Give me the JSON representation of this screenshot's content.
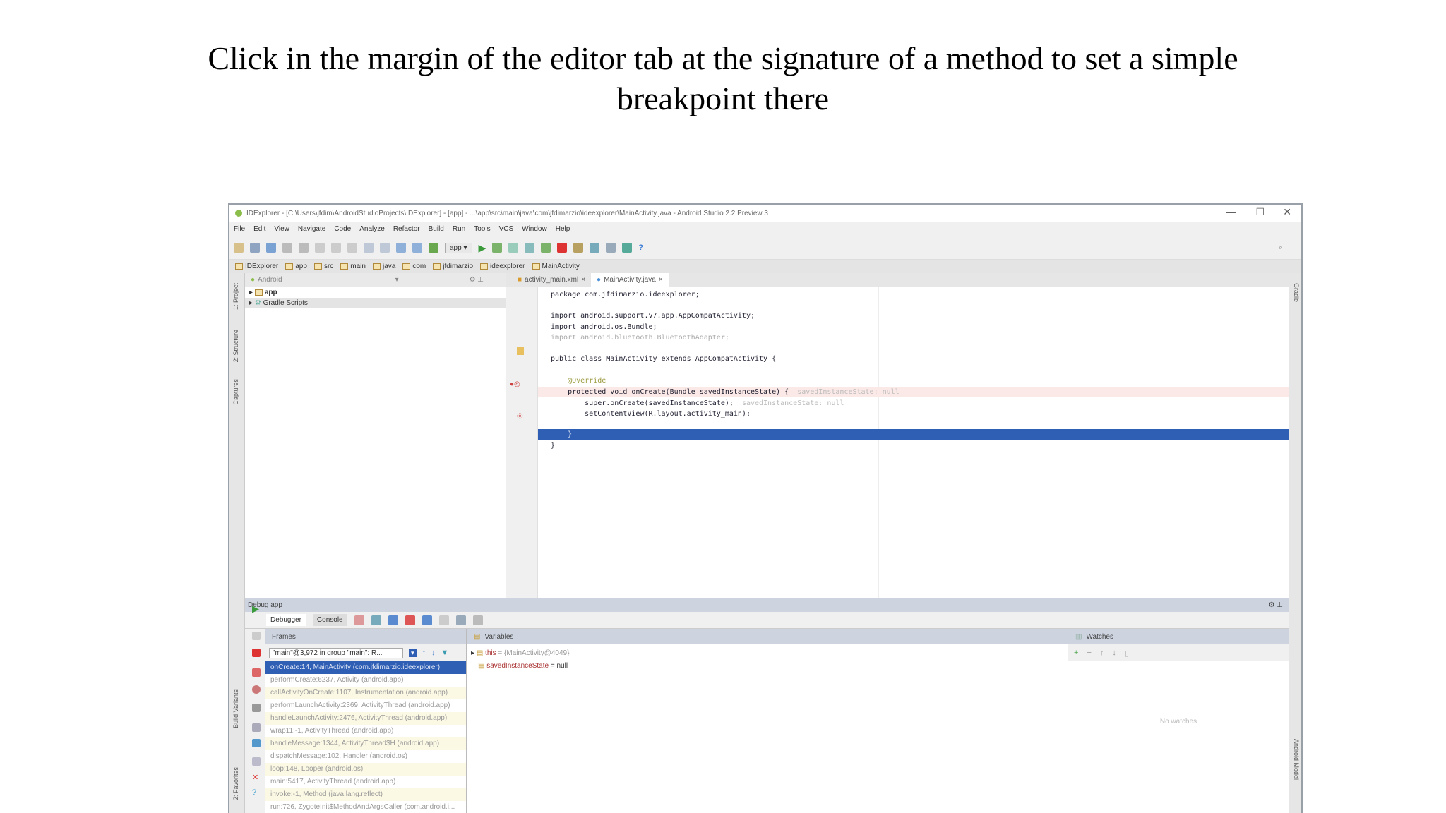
{
  "caption": {
    "line1": "Click in the margin of the editor tab at the signature of a method to set a simple",
    "line2": "breakpoint there"
  },
  "window": {
    "title": "IDExplorer - [C:\\Users\\jfdim\\AndroidStudioProjects\\IDExplorer] - [app] - ...\\app\\src\\main\\java\\com\\jfdimarzio\\ideexplorer\\MainActivity.java - Android Studio 2.2 Preview 3",
    "minimize": "—",
    "maximize": "☐",
    "close": "✕"
  },
  "menu": [
    "File",
    "Edit",
    "View",
    "Navigate",
    "Code",
    "Analyze",
    "Refactor",
    "Build",
    "Run",
    "Tools",
    "VCS",
    "Window",
    "Help"
  ],
  "toolbar": {
    "run_config": "app"
  },
  "breadcrumbs": [
    "IDExplorer",
    "app",
    "src",
    "main",
    "java",
    "com",
    "jfdimarzio",
    "ideexplorer",
    "MainActivity"
  ],
  "project": {
    "view": "Android",
    "items": [
      "app",
      "Gradle Scripts"
    ]
  },
  "left_strip": [
    "1: Project",
    "2: Structure",
    "Captures",
    "Build Variants",
    "2: Favorites"
  ],
  "right_strip": [
    "Gradle",
    "Android Model"
  ],
  "editor": {
    "tabs": [
      "activity_main.xml",
      "MainActivity.java"
    ],
    "active_tab": 1,
    "lines": [
      {
        "text": "package com.jfdimarzio.ideexplorer;",
        "hint": ""
      },
      {
        "text": "import android.support.v7.app.AppCompatActivity;",
        "hint": ""
      },
      {
        "text": "import android.os.Bundle;",
        "hint": ""
      },
      {
        "text": "import android.bluetooth.BluetoothAdapter;",
        "hint": ""
      },
      {
        "text": "public class MainActivity extends AppCompatActivity {",
        "hint": ""
      },
      {
        "text": "    @Override",
        "hint": ""
      },
      {
        "text": "    protected void onCreate(Bundle savedInstanceState) {",
        "hint": "savedInstanceState: null"
      },
      {
        "text": "        super.onCreate(savedInstanceState);",
        "hint": "savedInstanceState: null"
      },
      {
        "text": "        setContentView(R.layout.activity_main);",
        "hint": ""
      },
      {
        "text": "    }",
        "hint": ""
      },
      {
        "text": "}",
        "hint": ""
      }
    ]
  },
  "debug": {
    "title": "Debug",
    "config": "app",
    "tabs": [
      "Debugger",
      "Console"
    ],
    "frames_label": "Frames",
    "thread": "\"main\"@3,972 in group \"main\": R...",
    "frames": [
      "onCreate:14, MainActivity (com.jfdimarzio.ideexplorer)",
      "performCreate:6237, Activity (android.app)",
      "callActivityOnCreate:1107, Instrumentation (android.app)",
      "performLaunchActivity:2369, ActivityThread (android.app)",
      "handleLaunchActivity:2476, ActivityThread (android.app)",
      "wrap11:-1, ActivityThread (android.app)",
      "handleMessage:1344, ActivityThread$H (android.app)",
      "dispatchMessage:102, Handler (android.os)",
      "loop:148, Looper (android.os)",
      "main:5417, ActivityThread (android.app)",
      "invoke:-1, Method (java.lang.reflect)",
      "run:726, ZygoteInit$MethodAndArgsCaller (com.android.i..."
    ],
    "variables_label": "Variables",
    "variables": [
      {
        "name": "this",
        "value": "= {MainActivity@4049}"
      },
      {
        "name": "savedInstanceState",
        "value": "= null"
      }
    ],
    "watches_label": "Watches",
    "watches_empty": "No watches"
  },
  "colors": {
    "selection": "#2f5fb5",
    "breakpoint_line": "#fbe9e7",
    "panel_header": "#cdd4e0"
  }
}
